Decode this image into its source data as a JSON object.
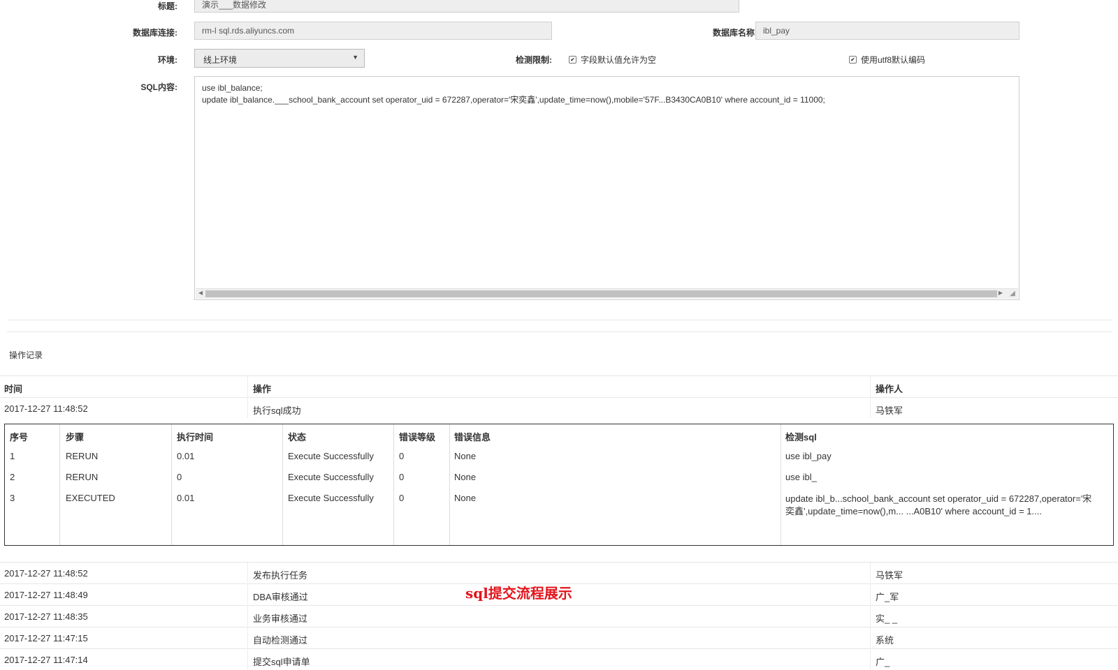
{
  "form": {
    "title_label": "标题:",
    "title_value": "演示___数据修改",
    "db_conn_label": "数据库连接:",
    "db_conn_value": "rm-l              sql.rds.aliyuncs.com",
    "db_name_label": "数据库名称:",
    "db_name_value": "ibl_pay",
    "env_label": "环境:",
    "env_value": "线上环境",
    "check_label": "检测限制:",
    "check_opt1": "字段默认值允许为空",
    "check_opt2": "使用utf8默认编码",
    "sql_label": "SQL内容:",
    "sql_line1": "use ibl_balance;",
    "sql_line2": "update ibl_balance.___school_bank_account set operator_uid = 672287,operator='宋奕鑫',update_time=now(),mobile='57F...B3430CA0B10' where account_id = 11000;"
  },
  "log": {
    "section_title": "操作记录",
    "headers": {
      "time": "时间",
      "action": "操作",
      "operator": "操作人"
    },
    "first_row": {
      "time": "2017-12-27 11:48:52",
      "action": "执行sql成功",
      "operator": "马铁军"
    },
    "steps": {
      "headers": [
        "序号",
        "步骤",
        "执行时间",
        "状态",
        "错误等级",
        "错误信息",
        "检测sql"
      ],
      "rows": [
        [
          "1",
          "RERUN",
          "0.01",
          "Execute Successfully",
          "0",
          "None",
          "use ibl_pay"
        ],
        [
          "2",
          "RERUN",
          "0",
          "Execute Successfully",
          "0",
          "None",
          "use ibl_"
        ],
        [
          "3",
          "EXECUTED",
          "0.01",
          "Execute Successfully",
          "0",
          "None",
          "update ibl_b...school_bank_account set operator_uid = 672287,operator='宋奕鑫',update_time=now(),m... ...A0B10' where account_id = 1...."
        ]
      ]
    },
    "rows": [
      {
        "time": "2017-12-27 11:48:52",
        "action": "发布执行任务",
        "operator": "马铁军"
      },
      {
        "time": "2017-12-27 11:48:49",
        "action": "DBA审核通过",
        "operator": "广_军"
      },
      {
        "time": "2017-12-27 11:48:35",
        "action": "业务审核通过",
        "operator": "实_ _"
      },
      {
        "time": "2017-12-27 11:47:15",
        "action": "自动检测通过",
        "operator": "系统"
      },
      {
        "time": "2017-12-27 11:47:14",
        "action": "提交sql申请单",
        "operator": "广_"
      }
    ]
  },
  "caption": "sql提交流程展示",
  "colors": {
    "caption": "#e3141c",
    "field_bg": "#eeeeee"
  }
}
